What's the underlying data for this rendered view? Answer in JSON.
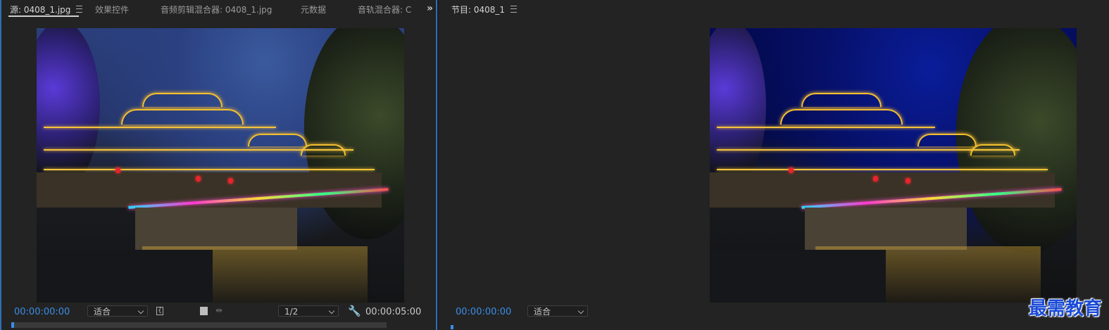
{
  "source": {
    "tabs": [
      {
        "label": "源: 0408_1.jpg",
        "active": true
      },
      {
        "label": "效果控件",
        "active": false
      },
      {
        "label": "音频剪辑混合器: 0408_1.jpg",
        "active": false
      },
      {
        "label": "元数据",
        "active": false
      },
      {
        "label": "音轨混合器: C",
        "active": false
      }
    ],
    "overflow_icon": "»",
    "timecode_start": "00:00:00:00",
    "zoom_select": "适合",
    "resolution_select": "1/2",
    "timecode_end": "00:00:05:00"
  },
  "program": {
    "title": "节目: 0408_1",
    "timecode_start": "00:00:00:00",
    "zoom_select": "适合"
  },
  "watermark": "最需教育",
  "colors": {
    "accent": "#3a8ee8",
    "panel_border": "#2d6fb4"
  },
  "icons": [
    "menu-icon",
    "overflow-chevrons-icon",
    "chevron-down-icon",
    "mark-in-bracket-icon",
    "export-frame-icon",
    "insert-arrows-icon",
    "wrench-icon"
  ]
}
